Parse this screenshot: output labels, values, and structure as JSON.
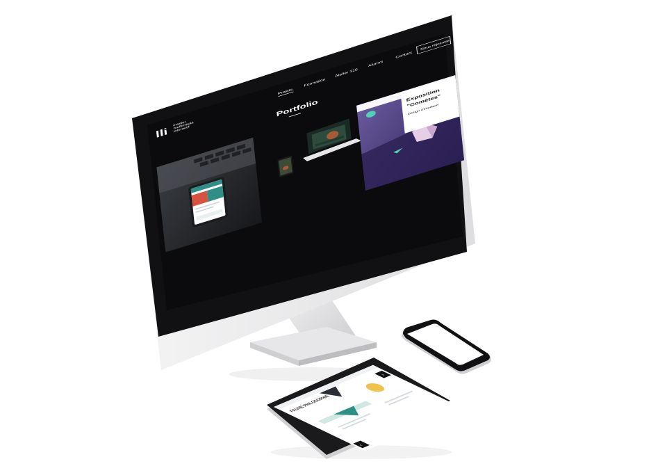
{
  "site": {
    "logo_mark": "lli",
    "logo_lines": [
      "master",
      "multimédia",
      "interactif"
    ],
    "nav": [
      {
        "label": "Projets",
        "active": true
      },
      {
        "label": "Formation",
        "active": false
      },
      {
        "label": "Atelier 310",
        "active": false
      },
      {
        "label": "Alumni",
        "active": false
      },
      {
        "label": "Contact",
        "active": false
      }
    ],
    "cta_label": "Nous rejoindre",
    "page_title": "Portfolio",
    "card3_title_line1": "Exposition",
    "card3_title_line2": "\"Comètes\"",
    "card3_subtitle": "Design d'interface"
  },
  "tablet": {
    "heading": "FAUNE PHILOSOPHIE",
    "prev_icon": "chevron-left-icon",
    "next_icon": "chevron-right-icon"
  },
  "colors": {
    "screen_bg": "#0b0b0d",
    "accent_teal": "#2e8f87",
    "accent_coral": "#d8533f",
    "card3_purple": "#3a2c6a",
    "device_silver": "#d9d9db"
  }
}
